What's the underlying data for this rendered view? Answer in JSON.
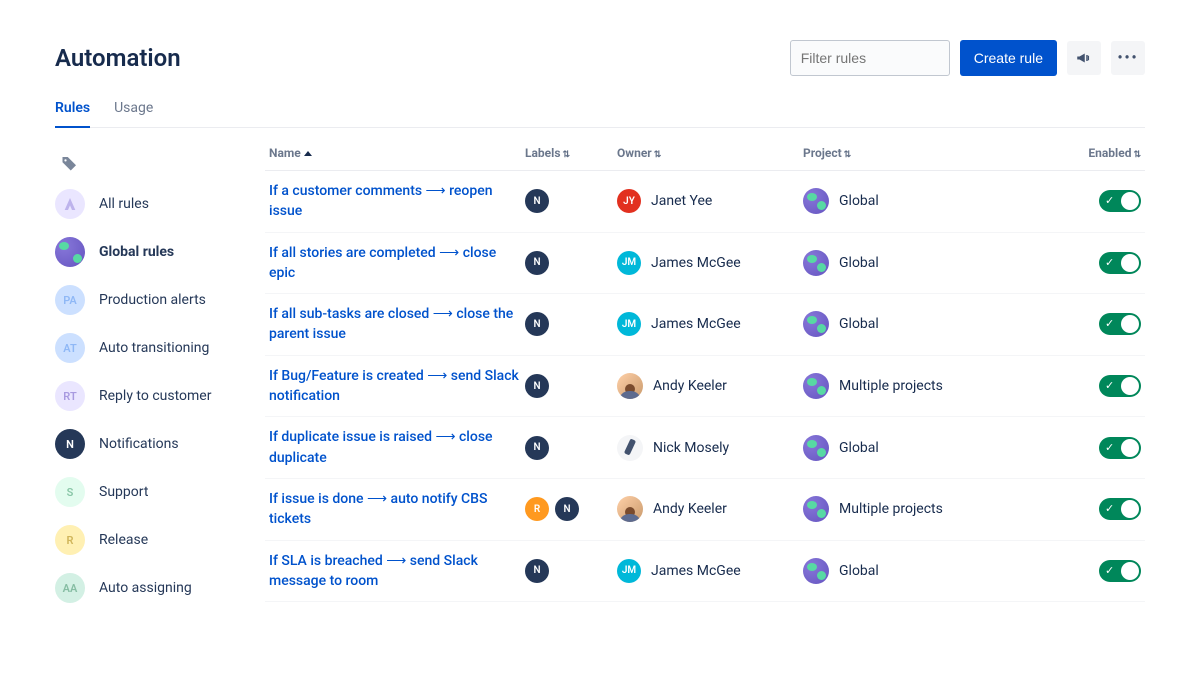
{
  "header": {
    "title": "Automation",
    "filter_placeholder": "Filter rules",
    "create_label": "Create rule"
  },
  "tabs": [
    {
      "label": "Rules",
      "active": true
    },
    {
      "label": "Usage",
      "active": false
    }
  ],
  "sidebar": {
    "items": [
      {
        "label": "All rules",
        "initials": "",
        "color": "#EAE6FF",
        "icon": "atlassian",
        "selected": false
      },
      {
        "label": "Global rules",
        "initials": "",
        "color": "globe",
        "icon": "globe",
        "selected": true
      },
      {
        "label": "Production alerts",
        "initials": "PA",
        "color": "#CCE0FF",
        "text": "#8FB8F6",
        "selected": false
      },
      {
        "label": "Auto transitioning",
        "initials": "AT",
        "color": "#CCE0FF",
        "text": "#8FB8F6",
        "selected": false
      },
      {
        "label": "Reply to customer",
        "initials": "RT",
        "color": "#EAE6FF",
        "text": "#A89AE0",
        "selected": false
      },
      {
        "label": "Notifications",
        "initials": "N",
        "color": "#253858",
        "text": "#fff",
        "selected": false
      },
      {
        "label": "Support",
        "initials": "S",
        "color": "#E3FCEF",
        "text": "#8AC7A8",
        "selected": false
      },
      {
        "label": "Release",
        "initials": "R",
        "color": "#FFF0B3",
        "text": "#D0B55A",
        "selected": false
      },
      {
        "label": "Auto assigning",
        "initials": "AA",
        "color": "#D3F0E4",
        "text": "#86BDA3",
        "selected": false
      }
    ]
  },
  "table": {
    "columns": {
      "name": "Name",
      "labels": "Labels",
      "owner": "Owner",
      "project": "Project",
      "enabled": "Enabled"
    },
    "rows": [
      {
        "name": "If a customer comments ⟶ reopen issue",
        "labels": [
          {
            "t": "N",
            "bg": "#253858"
          }
        ],
        "owner": {
          "name": "Janet Yee",
          "initials": "JY",
          "bg": "#E2301F",
          "type": "initials"
        },
        "project": "Global",
        "enabled": true
      },
      {
        "name": "If all stories are completed ⟶ close epic",
        "labels": [
          {
            "t": "N",
            "bg": "#253858"
          }
        ],
        "owner": {
          "name": "James McGee",
          "initials": "JM",
          "bg": "#00B8D9",
          "type": "initials"
        },
        "project": "Global",
        "enabled": true
      },
      {
        "name": "If all sub-tasks are closed ⟶ close the parent issue",
        "labels": [
          {
            "t": "N",
            "bg": "#253858"
          }
        ],
        "owner": {
          "name": "James McGee",
          "initials": "JM",
          "bg": "#00B8D9",
          "type": "initials"
        },
        "project": "Global",
        "enabled": true
      },
      {
        "name": "If Bug/Feature is created ⟶ send Slack notification",
        "labels": [
          {
            "t": "N",
            "bg": "#253858"
          }
        ],
        "owner": {
          "name": "Andy Keeler",
          "type": "photo"
        },
        "project": "Multiple projects",
        "enabled": true
      },
      {
        "name": "If duplicate issue is raised ⟶ close duplicate",
        "labels": [
          {
            "t": "N",
            "bg": "#253858"
          }
        ],
        "owner": {
          "name": "Nick Mosely",
          "type": "nick"
        },
        "project": "Global",
        "enabled": true
      },
      {
        "name": "If issue is done ⟶ auto notify CBS tickets",
        "labels": [
          {
            "t": "R",
            "bg": "#FF991F"
          },
          {
            "t": "N",
            "bg": "#253858"
          }
        ],
        "owner": {
          "name": "Andy Keeler",
          "type": "photo"
        },
        "project": "Multiple projects",
        "enabled": true
      },
      {
        "name": "If SLA is breached ⟶ send Slack message to room",
        "labels": [
          {
            "t": "N",
            "bg": "#253858"
          }
        ],
        "owner": {
          "name": "James McGee",
          "initials": "JM",
          "bg": "#00B8D9",
          "type": "initials"
        },
        "project": "Global",
        "enabled": true
      }
    ]
  }
}
